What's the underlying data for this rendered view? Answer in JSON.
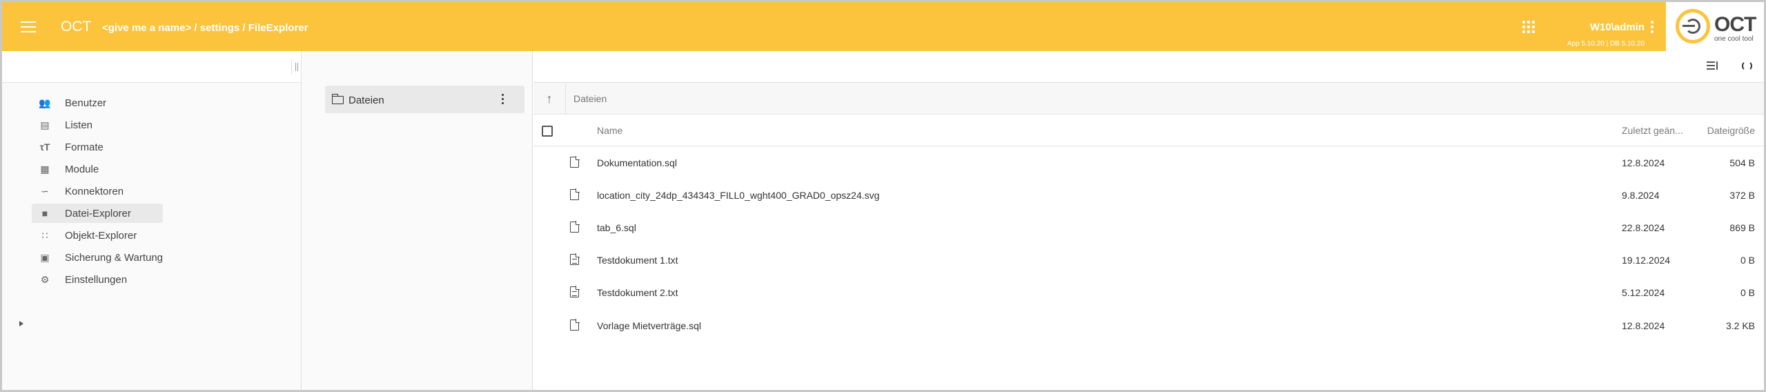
{
  "header": {
    "app_title": "OCT",
    "breadcrumb": "<give me a name> / settings / FileExplorer",
    "user": "W10\\admin",
    "version": "App 5.10.20 | DB 5.10.20",
    "logo_word": "OCT",
    "logo_sub": "one cool tool",
    "accent_color": "#fcc43c"
  },
  "sidebar": {
    "items": [
      {
        "label": "Benutzer",
        "icon": "users-icon"
      },
      {
        "label": "Listen",
        "icon": "list-icon"
      },
      {
        "label": "Formate",
        "icon": "format-icon"
      },
      {
        "label": "Module",
        "icon": "puzzle-icon"
      },
      {
        "label": "Konnektoren",
        "icon": "connector-icon"
      },
      {
        "label": "Datei-Explorer",
        "icon": "folder-icon",
        "active": true
      },
      {
        "label": "Objekt-Explorer",
        "icon": "grid-icon"
      },
      {
        "label": "Sicherung & Wartung",
        "icon": "backup-icon"
      },
      {
        "label": "Einstellungen",
        "icon": "gear-icon",
        "expandable": true
      }
    ]
  },
  "folders": {
    "root_label": "Dateien"
  },
  "main": {
    "path": "Dateien",
    "columns": {
      "name": "Name",
      "date": "Zuletzt geän...",
      "size": "Dateigröße"
    },
    "files": [
      {
        "name": "Dokumentation.sql",
        "date": "12.8.2024",
        "size": "504 B",
        "icon": "file-icon"
      },
      {
        "name": "location_city_24dp_434343_FILL0_wght400_GRAD0_opsz24.svg",
        "date": "9.8.2024",
        "size": "372 B",
        "icon": "file-icon"
      },
      {
        "name": "tab_6.sql",
        "date": "22.8.2024",
        "size": "869 B",
        "icon": "file-icon"
      },
      {
        "name": "Testdokument 1.txt",
        "date": "19.12.2024",
        "size": "0 B",
        "icon": "text-file-icon"
      },
      {
        "name": "Testdokument 2.txt",
        "date": "5.12.2024",
        "size": "0 B",
        "icon": "text-file-icon"
      },
      {
        "name": "Vorlage Mietverträge.sql",
        "date": "12.8.2024",
        "size": "3.2 KB",
        "icon": "file-icon"
      }
    ]
  }
}
